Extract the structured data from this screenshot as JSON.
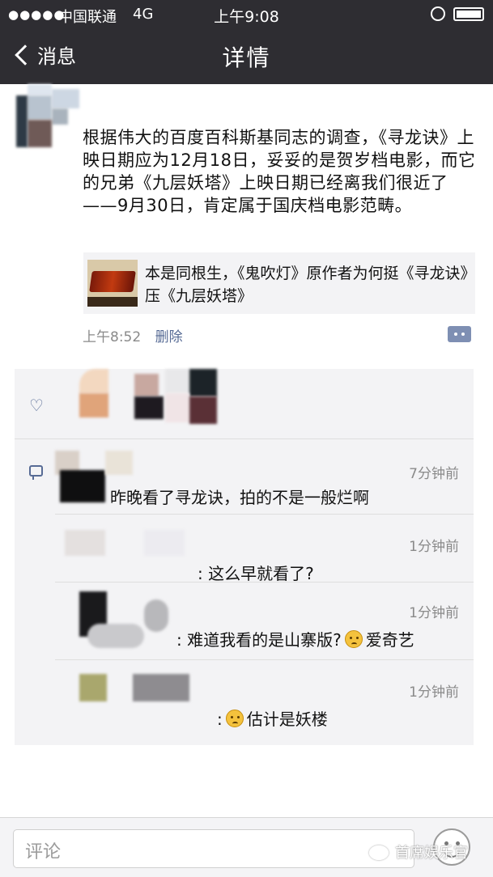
{
  "status_bar": {
    "signal": "●●●●●",
    "carrier": "中国联通",
    "network": "4G",
    "time": "上午9:08"
  },
  "nav": {
    "back_label": "消息",
    "title": "详情"
  },
  "post": {
    "text": "根据伟大的百度百科斯基同志的调查，《寻龙诀》上映日期应为12月18日，妥妥的是贺岁档电影，而它的兄弟《九层妖塔》上映日期已经离我们很近了——9月30日，肯定属于国庆档电影范畴。",
    "share_title": "本是同根生，《鬼吹灯》原作者为何挺《寻龙诀》压《九层妖塔》",
    "time": "上午8:52",
    "delete_label": "删除"
  },
  "comments": [
    {
      "time": "7分钟前",
      "text": "昨晚看了寻龙诀，拍的不是一般烂啊"
    },
    {
      "time": "1分钟前",
      "text": ": 这么早就看了?"
    },
    {
      "time": "1分钟前",
      "text": ": 难道我看的是山寨版?",
      "emoji": "shocked-emoji",
      "text_after": "爱奇艺"
    },
    {
      "time": "1分钟前",
      "text": "估计是妖楼",
      "emoji": "worried-emoji",
      "prefix": ":"
    }
  ],
  "input": {
    "placeholder": "评论"
  },
  "watermark": "首席娱乐官",
  "colors": {
    "nav_bg": "#2e2d32",
    "link": "#576b95",
    "meta_gray": "#8a8a8a"
  }
}
